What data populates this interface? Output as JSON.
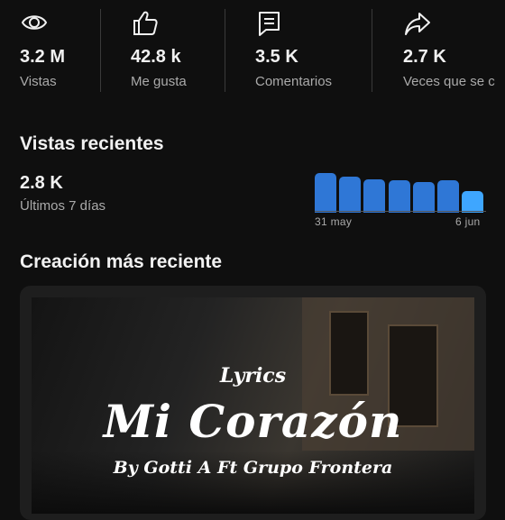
{
  "stats": [
    {
      "icon": "eye-icon",
      "value": "3.2 M",
      "label": "Vistas"
    },
    {
      "icon": "thumbs-up-icon",
      "value": "42.8 k",
      "label": "Me gusta"
    },
    {
      "icon": "comment-icon",
      "value": "3.5 K",
      "label": "Comentarios"
    },
    {
      "icon": "share-icon",
      "value": "2.7 K",
      "label": "Veces que se c"
    }
  ],
  "recent": {
    "title": "Vistas recientes",
    "value": "2.8 K",
    "period_label": "Últimos 7 días",
    "chart_data": {
      "type": "bar",
      "values": [
        44,
        40,
        37,
        36,
        34,
        36,
        24
      ],
      "ylim": [
        0,
        44
      ],
      "tick_labels": [
        "31 may",
        "6 jun"
      ],
      "colors": {
        "default": "#2f77d6",
        "highlight": "#3ea6ff"
      }
    }
  },
  "latest": {
    "title": "Creación más reciente",
    "thumbnail": {
      "small_text": "Lyrics",
      "big_text": "Mi Corazón",
      "by_text": "By Gotti A Ft Grupo Frontera"
    }
  }
}
